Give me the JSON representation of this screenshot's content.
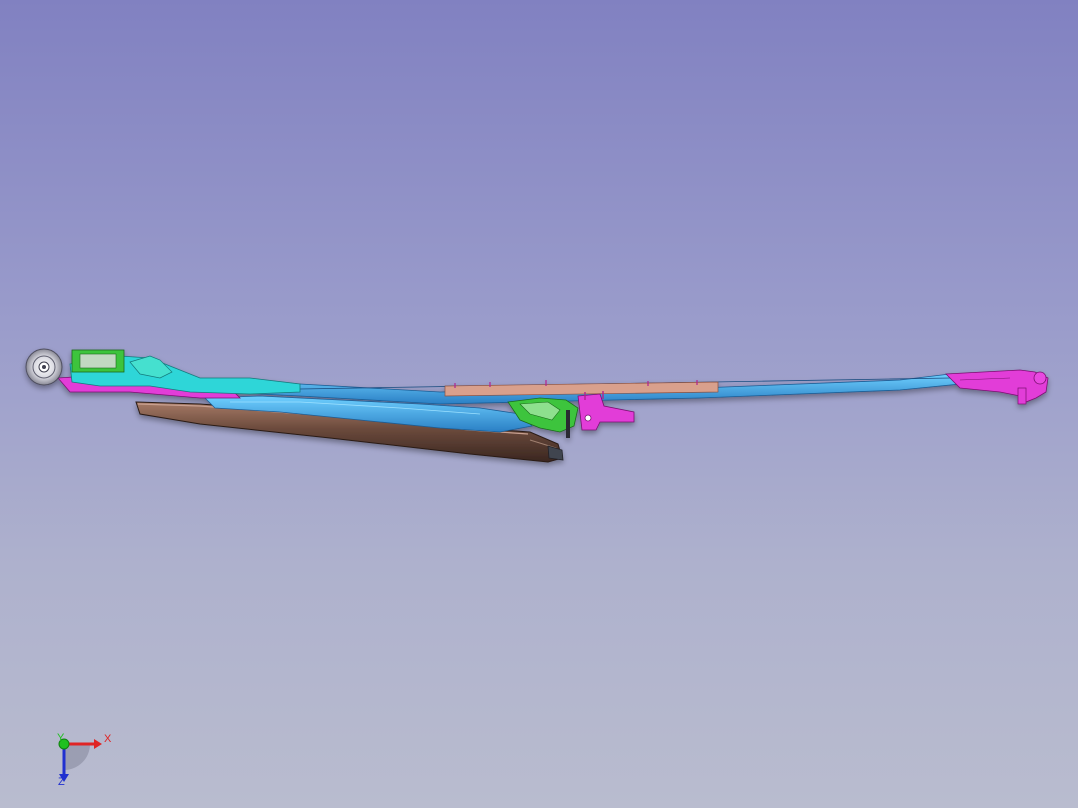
{
  "viewer": {
    "background_top": "#8181c1",
    "background_bottom": "#b9bccf"
  },
  "model": {
    "part_colors": {
      "arm_blue": "#3fa8e6",
      "arm_cyan": "#2ed6d8",
      "bracket_magenta": "#e23cd8",
      "blade_brown": "#6b4a3c",
      "rail_salmon": "#d9a08c",
      "clip_green": "#3ec43e",
      "pivot_white": "#e8e8ee"
    }
  },
  "axis_triad": {
    "x_label": "X",
    "y_label": "Y",
    "z_label": "Z",
    "x_color": "#e02424",
    "y_color": "#20c020",
    "z_color": "#2030d0"
  }
}
